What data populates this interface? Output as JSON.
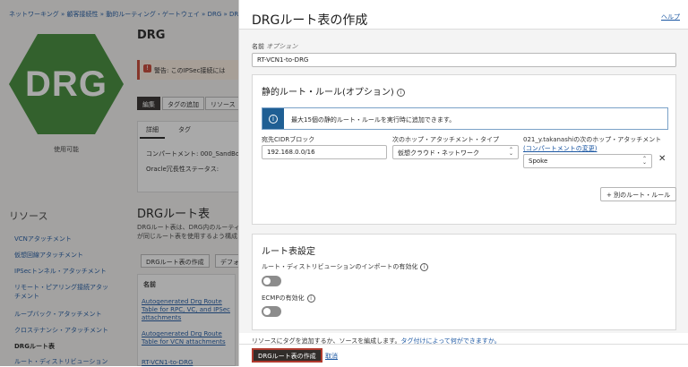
{
  "background": {
    "breadcrumb": "ネットワーキング » 顧客接続性 » 動的ルーティング・ゲートウェイ » DRG » DRGルート表",
    "logo_text": "DRG",
    "status": "使用可能",
    "page_title": "DRG",
    "warning": "警告: このIPSec接続には",
    "buttons": [
      "編集",
      "タグの追加",
      "リソース"
    ],
    "tabs": [
      "詳細",
      "タグ"
    ],
    "compartment_label": "コンパートメント: 000_SandBo",
    "redundancy_label": "Oracle冗長性ステータス:",
    "resources_title": "リソース",
    "sidebar_items": [
      "VCNアタッチメント",
      "仮想回線アタッチメント",
      "IPSecトンネル・アタッチメント",
      "リモート・ピアリング接続アタッ",
      "チメント",
      "ループバック・アタッチメント",
      "クロステナンシ・アタッチメント",
      "DRGルート表",
      "ルート・ディストリビューション"
    ],
    "section_title": "DRGルート表",
    "section_desc_1": "DRGルート表は、DRG内のルーティ",
    "section_desc_2": "が同じルート表を使用するよう構成",
    "create_button": "DRGルート表の作成",
    "default_button": "デフォ",
    "table_header": "名前",
    "table_rows": [
      "Autogenerated Drg Route",
      "Table for RPC, VC, and IPSec",
      "attachments",
      "Autogenerated Drg Route",
      "Table for VCN attachments",
      "RT-VCN1-to-DRG"
    ]
  },
  "panel": {
    "title": "DRGルート表の作成",
    "help_link": "ヘルプ",
    "name_label": "名前",
    "name_optional": "オプション",
    "name_value": "RT-VCN1-to-DRG",
    "static_rules_title": "静的ルート・ルール(オプション)",
    "info_text": "最大15個の静的ルート・ルールを実行時に追加できます。",
    "cidr_label": "宛先CIDRブロック",
    "cidr_value": "192.168.0.0/16",
    "next_hop_type_label": "次のホップ・アタッチメント・タイプ",
    "next_hop_type_value": "仮想クラウド・ネットワーク",
    "next_hop_label": "021_y.takanashiの次のホップ・アタッチメント",
    "change_compartment_link": "(コンパートメントの変更)",
    "next_hop_value": "Spoke",
    "add_rule_button": "+ 別のルート・ルール",
    "route_settings_title": "ルート表設定",
    "import_label": "ルート・ディストリビューションのインポートの有効化",
    "ecmp_label": "ECMPの有効化",
    "footer_text": "リソースにタグを追加するか、ソースを編成します。",
    "footer_link": "タグ付けによって何ができますか。",
    "create_button": "DRGルート表の作成",
    "cancel_link": "取消"
  }
}
